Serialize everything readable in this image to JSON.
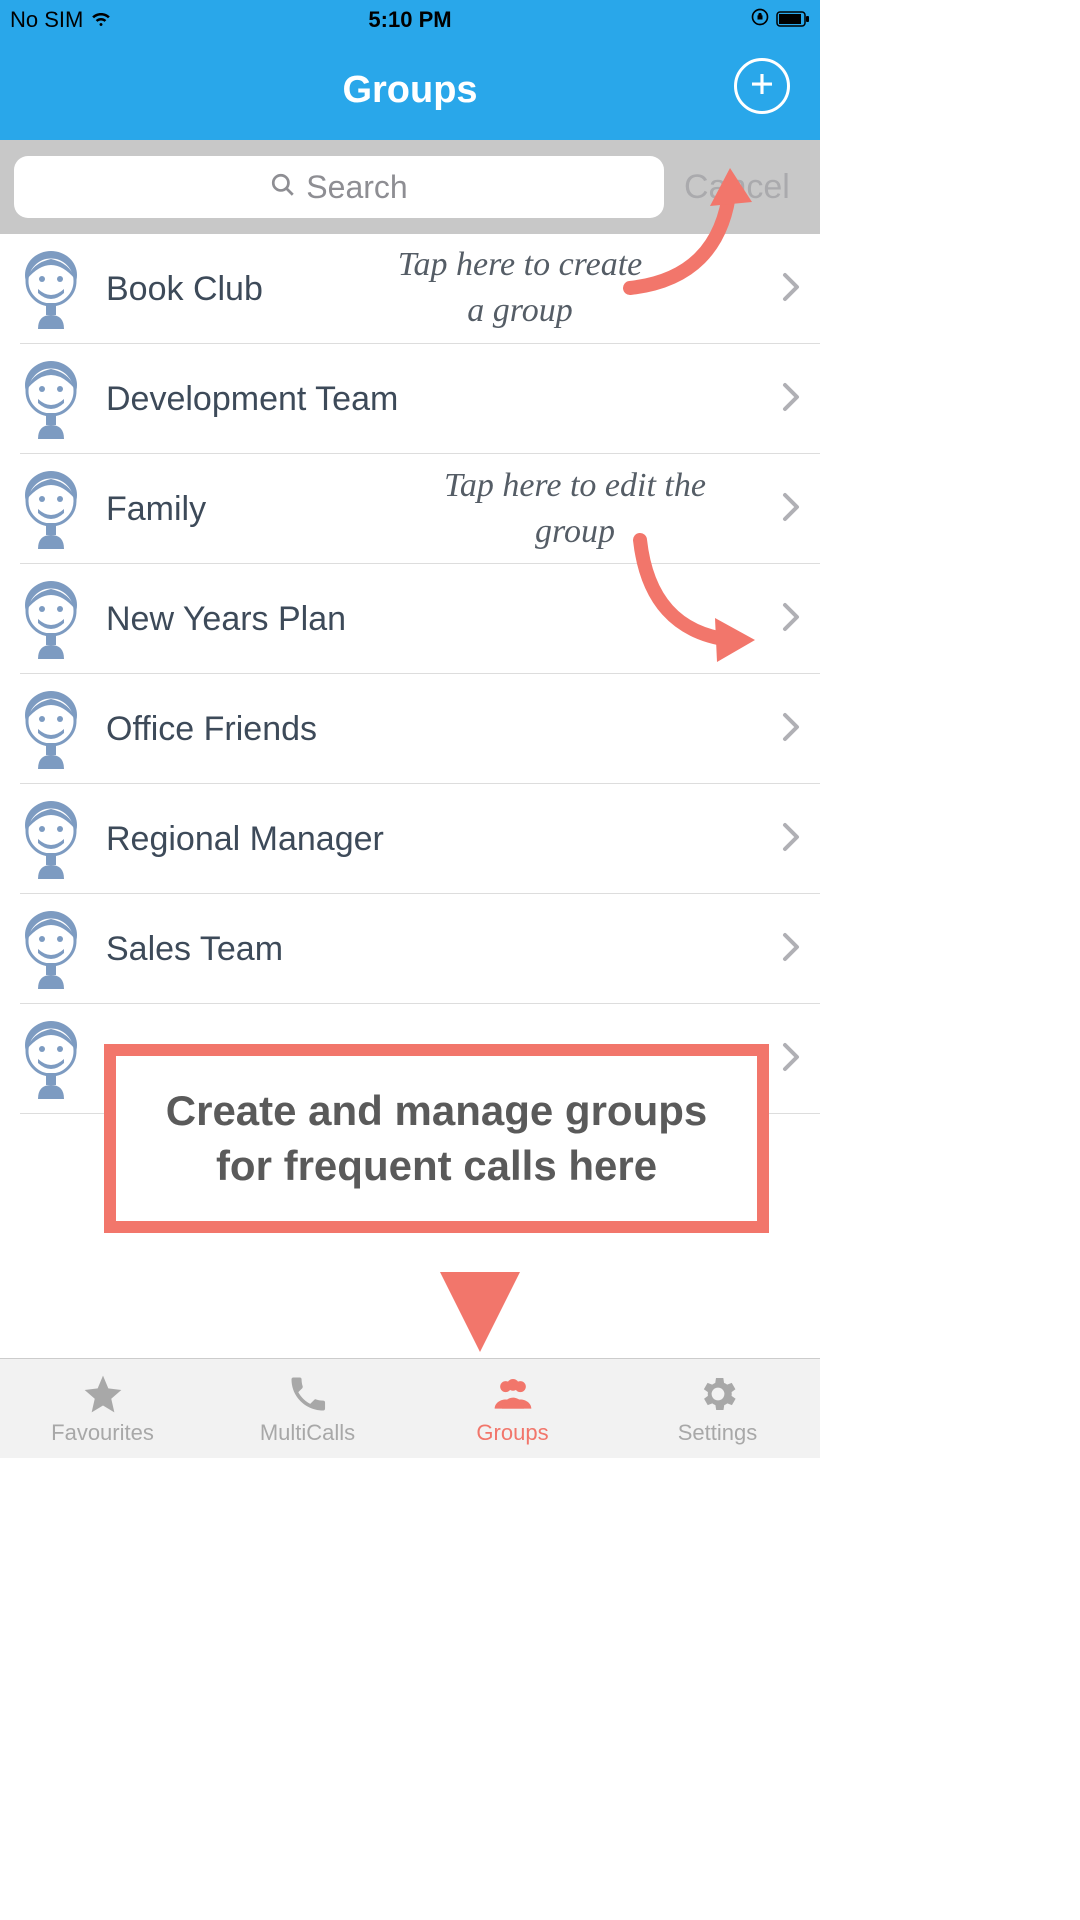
{
  "status": {
    "carrier": "No SIM",
    "time": "5:10 PM"
  },
  "nav": {
    "title": "Groups"
  },
  "search": {
    "placeholder": "Search",
    "cancel": "Cancel"
  },
  "groups": [
    {
      "name": "Book Club"
    },
    {
      "name": "Development Team"
    },
    {
      "name": "Family"
    },
    {
      "name": "New Years Plan"
    },
    {
      "name": "Office Friends"
    },
    {
      "name": "Regional Manager"
    },
    {
      "name": "Sales Team"
    },
    {
      "name": ""
    }
  ],
  "annotations": {
    "create": "Tap here to create a group",
    "edit": "Tap here to edit the group",
    "callout": "Create and manage groups for frequent calls here"
  },
  "tabs": [
    {
      "label": "Favourites",
      "active": false
    },
    {
      "label": "MultiCalls",
      "active": false
    },
    {
      "label": "Groups",
      "active": true
    },
    {
      "label": "Settings",
      "active": false
    }
  ]
}
